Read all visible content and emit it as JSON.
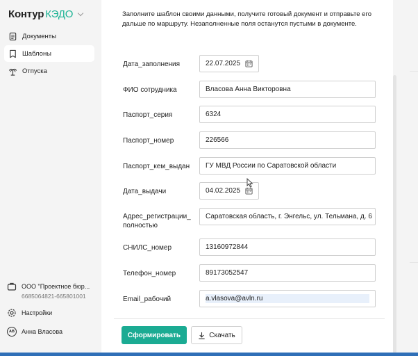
{
  "brand": {
    "part1": "Контур",
    "part2": "КЭДО"
  },
  "sidebar": {
    "items": [
      {
        "label": "Документы",
        "icon": "document-icon"
      },
      {
        "label": "Шаблоны",
        "icon": "template-icon",
        "active": true
      },
      {
        "label": "Отпуска",
        "icon": "palm-tree-icon"
      }
    ],
    "org": {
      "name": "ООО \"Проектное бюр...",
      "inn": "6685064821-665801001"
    },
    "settings_label": "Настройки",
    "user": {
      "initials": "АВ",
      "name": "Анна Власова"
    }
  },
  "form": {
    "intro": "Заполните шаблон своими данными, получите готовый документ и отправьте его дальше по маршруту. Незаполненные поля останутся пустыми в документе.",
    "fields": [
      {
        "label": "Дата_заполнения",
        "value": "22.07.2025"
      },
      {
        "label": "ФИО сотрудника",
        "value": "Власова Анна Викторовна"
      },
      {
        "label": "Паспорт_серия",
        "value": "6324"
      },
      {
        "label": "Паспорт_номер",
        "value": "226566"
      },
      {
        "label": "Паспорт_кем_выдан",
        "value": "ГУ МВД России по Саратовской области"
      },
      {
        "label": "Дата_выдачи",
        "value": "04.02.2025"
      },
      {
        "label": "Адрес_регистрации_ полностью",
        "value": "Саратовская область, г. Энгельс, ул. Тельмана, д. 6"
      },
      {
        "label": "СНИЛС_номер",
        "value": "13160972844"
      },
      {
        "label": "Телефон_номер",
        "value": "89173052547"
      },
      {
        "label": "Email_рабочий",
        "value": "a.vlasova@avln.ru"
      }
    ]
  },
  "actions": {
    "generate_label": "Сформировать",
    "download_label": "Скачать"
  },
  "colors": {
    "accent": "#1bab93",
    "brand_green": "#1ab394"
  }
}
